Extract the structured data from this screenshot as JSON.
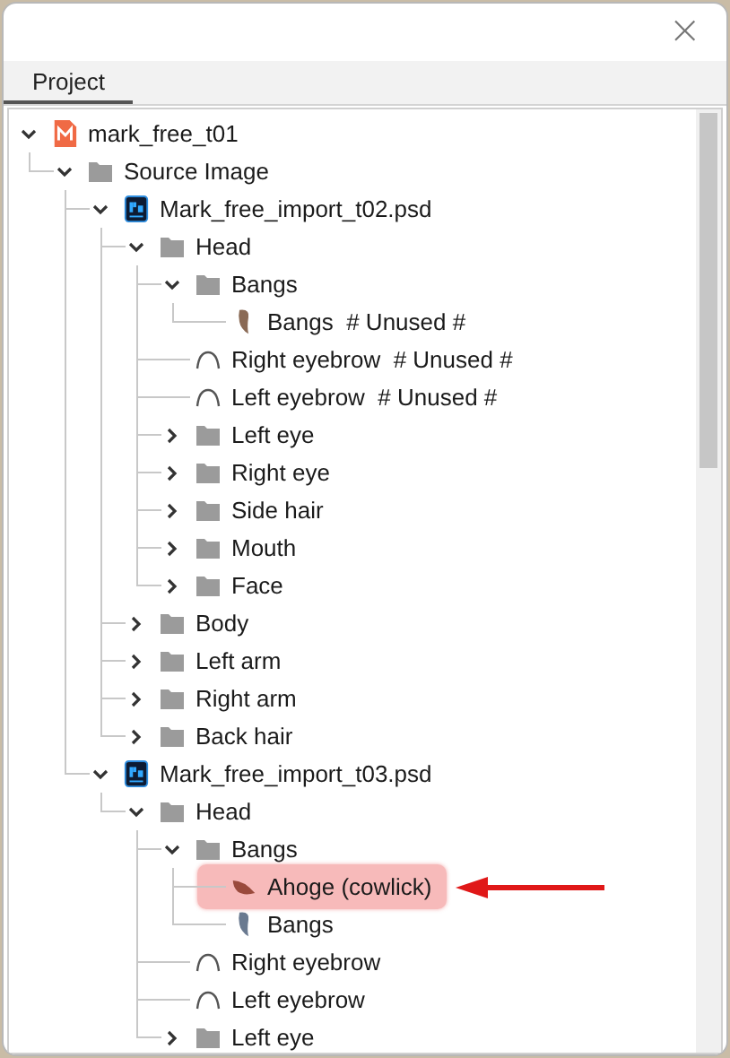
{
  "window": {
    "close": "×"
  },
  "tabs": [
    {
      "label": "Project",
      "selected": true
    }
  ],
  "tree": [
    {
      "label": "mark_free_t01",
      "kind": "project",
      "expanded": true,
      "marked": false,
      "children": [
        {
          "label": "Source Image",
          "kind": "folder",
          "expanded": true,
          "marked": false,
          "children": [
            {
              "label": "Mark_free_import_t02.psd",
              "kind": "psd",
              "expanded": true,
              "marked": false,
              "children": [
                {
                  "label": "Head",
                  "kind": "folder",
                  "expanded": true,
                  "marked": false,
                  "children": [
                    {
                      "label": "Bangs",
                      "kind": "folder",
                      "expanded": true,
                      "marked": false,
                      "children": [
                        {
                          "label": "Bangs  # Unused #",
                          "kind": "strand",
                          "color": "#8a6a55",
                          "marked": false
                        }
                      ]
                    },
                    {
                      "label": "Right eyebrow  # Unused #",
                      "kind": "brow",
                      "marked": false
                    },
                    {
                      "label": "Left eyebrow  # Unused #",
                      "kind": "brow",
                      "marked": false
                    },
                    {
                      "label": "Left eye",
                      "kind": "folder",
                      "expanded": false,
                      "marked": false
                    },
                    {
                      "label": "Right eye",
                      "kind": "folder",
                      "expanded": false,
                      "marked": false
                    },
                    {
                      "label": "Side hair",
                      "kind": "folder",
                      "expanded": false,
                      "marked": false
                    },
                    {
                      "label": "Mouth",
                      "kind": "folder",
                      "expanded": false,
                      "marked": false
                    },
                    {
                      "label": "Face",
                      "kind": "folder",
                      "expanded": false,
                      "marked": false
                    }
                  ]
                },
                {
                  "label": "Body",
                  "kind": "folder",
                  "expanded": false,
                  "marked": false
                },
                {
                  "label": "Left arm",
                  "kind": "folder",
                  "expanded": false,
                  "marked": false
                },
                {
                  "label": "Right arm",
                  "kind": "folder",
                  "expanded": false,
                  "marked": false
                },
                {
                  "label": "Back hair",
                  "kind": "folder",
                  "expanded": false,
                  "marked": false
                }
              ]
            },
            {
              "label": "Mark_free_import_t03.psd",
              "kind": "psd",
              "expanded": true,
              "marked": false,
              "children": [
                {
                  "label": "Head",
                  "kind": "folder",
                  "expanded": true,
                  "marked": false,
                  "children": [
                    {
                      "label": "Bangs",
                      "kind": "folder",
                      "expanded": true,
                      "marked": false,
                      "children": [
                        {
                          "label": "Ahoge (cowlick)",
                          "kind": "crescent",
                          "color": "#9a4a3c",
                          "marked": true
                        },
                        {
                          "label": "Bangs",
                          "kind": "strand",
                          "color": "#6a7a90",
                          "marked": false
                        }
                      ]
                    },
                    {
                      "label": "Right eyebrow",
                      "kind": "brow",
                      "marked": false
                    },
                    {
                      "label": "Left eyebrow",
                      "kind": "brow",
                      "marked": false
                    },
                    {
                      "label": "Left eye",
                      "kind": "folder",
                      "expanded": false,
                      "marked": false
                    }
                  ]
                }
              ]
            }
          ]
        }
      ]
    }
  ]
}
